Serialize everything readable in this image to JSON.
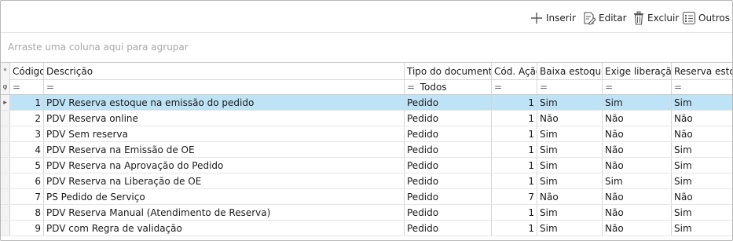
{
  "toolbar": {
    "insert_label": "Inserir",
    "edit_label": "Editar",
    "delete_label": "Excluir",
    "others_label": "Outros"
  },
  "group_panel": {
    "placeholder": "Arraste uma coluna aqui para agrupar"
  },
  "columns": [
    {
      "label": "Código"
    },
    {
      "label": "Descrição"
    },
    {
      "label": "Tipo do documento"
    },
    {
      "label": "Cód. Ação"
    },
    {
      "label": "Baixa estoque"
    },
    {
      "label": "Exige liberação"
    },
    {
      "label": "Reserva estoq"
    }
  ],
  "filters": {
    "eq_symbol": "=",
    "tipo_value": "Todos"
  },
  "indicators": {
    "header": "*",
    "filter": "φ",
    "selected": "▸"
  },
  "rows": [
    {
      "codigo": "1",
      "descricao": "PDV Reserva estoque na emissão do pedido",
      "tipo": "Pedido",
      "acao": "1",
      "baixa": "Sim",
      "exige": "Sim",
      "reserva": "Sim"
    },
    {
      "codigo": "2",
      "descricao": "PDV Reserva online",
      "tipo": "Pedido",
      "acao": "1",
      "baixa": "Não",
      "exige": "Não",
      "reserva": "Não"
    },
    {
      "codigo": "3",
      "descricao": "PDV Sem reserva",
      "tipo": "Pedido",
      "acao": "1",
      "baixa": "Sim",
      "exige": "Não",
      "reserva": "Não"
    },
    {
      "codigo": "4",
      "descricao": "PDV Reserva na Emissão de OE",
      "tipo": "Pedido",
      "acao": "1",
      "baixa": "Sim",
      "exige": "Não",
      "reserva": "Sim"
    },
    {
      "codigo": "5",
      "descricao": "PDV Reserva na Aprovação do Pedido",
      "tipo": "Pedido",
      "acao": "1",
      "baixa": "Sim",
      "exige": "Não",
      "reserva": "Sim"
    },
    {
      "codigo": "6",
      "descricao": "PDV Reserva na Liberação de OE",
      "tipo": "Pedido",
      "acao": "1",
      "baixa": "Sim",
      "exige": "Sim",
      "reserva": "Sim"
    },
    {
      "codigo": "7",
      "descricao": "PS Pedido de Serviço",
      "tipo": "Pedido",
      "acao": "7",
      "baixa": "Não",
      "exige": "Não",
      "reserva": "Não"
    },
    {
      "codigo": "8",
      "descricao": "PDV Reserva Manual (Atendimento de Reserva)",
      "tipo": "Pedido",
      "acao": "1",
      "baixa": "Sim",
      "exige": "Não",
      "reserva": "Sim"
    },
    {
      "codigo": "9",
      "descricao": "PDV com Regra de validação",
      "tipo": "Pedido",
      "acao": "1",
      "baixa": "Sim",
      "exige": "Não",
      "reserva": "Sim"
    }
  ]
}
